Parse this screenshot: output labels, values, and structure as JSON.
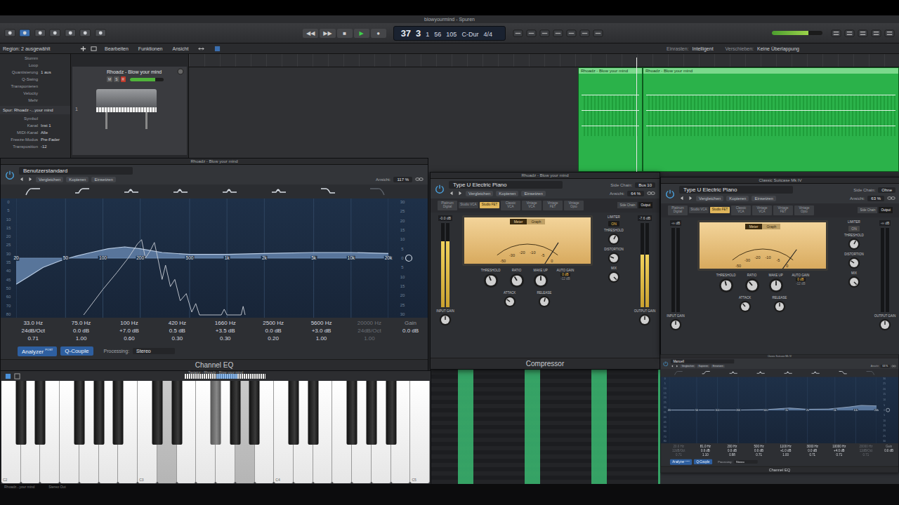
{
  "window": {
    "title": "blowyourmind - Spuren"
  },
  "toolbar": {
    "transport": [
      {
        "icon": "◀◀",
        "selected": false
      },
      {
        "icon": "▶▶",
        "selected": false
      },
      {
        "icon": "■",
        "selected": false
      },
      {
        "icon": "▶",
        "selected": true
      },
      {
        "icon": "●",
        "selected": false
      }
    ],
    "lcd": [
      {
        "value": "37",
        "kind": "position"
      },
      {
        "value": "3",
        "kind": "position"
      },
      {
        "value": "1",
        "kind": "info"
      },
      {
        "value": "56",
        "kind": "info"
      },
      {
        "value": "105",
        "kind": "info"
      },
      {
        "value": "C-Dur",
        "kind": "info"
      },
      {
        "value": "4/4",
        "kind": "info"
      }
    ],
    "master_level": 0.72
  },
  "inspector": {
    "region_title": "Region: 2 ausgewählt",
    "region_params": [
      {
        "label": "Stumm",
        "value": ""
      },
      {
        "label": "Loop",
        "value": ""
      },
      {
        "label": "Quantisierung",
        "value": "1 aus"
      },
      {
        "label": "Q-Swing",
        "value": ""
      },
      {
        "label": "Transponieren",
        "value": ""
      },
      {
        "label": "Velocity",
        "value": ""
      },
      {
        "label": "Mehr",
        "value": ""
      }
    ],
    "track_title": "Spur: Rhoadz -...your mind",
    "track_params": [
      {
        "label": "Symbol",
        "value": ""
      },
      {
        "label": "Kanal",
        "value": "Inst 1"
      },
      {
        "label": "MIDI-Kanal",
        "value": "Alle"
      },
      {
        "label": "Freeze-Modus",
        "value": "Pre-Fader"
      },
      {
        "label": "Transposition",
        "value": "-12"
      }
    ]
  },
  "track": {
    "number": "1",
    "name": "Rhoadz - Blow your mind",
    "buttons": [
      {
        "label": "M",
        "on": false
      },
      {
        "label": "S",
        "on": false
      },
      {
        "label": "R",
        "on": true
      }
    ],
    "volume": 0.75
  },
  "arrange": {
    "menus": [
      "Bearbeiten",
      "Funktionen",
      "Ansicht"
    ],
    "snap_label": "Einrasten:",
    "snap": "Intelligent",
    "drag_label": "Verschieben:",
    "drag": "Keine Überlappung",
    "regions": [
      {
        "name": "Rhoadz - Blow your mind",
        "selected": true
      },
      {
        "name": "Rhoadz - Blow your mind",
        "selected": true
      }
    ]
  },
  "eqs": [
    {
      "title": "Rhoadz - Blow your mind",
      "preset": "Benutzerstandard",
      "buttons": [
        "Vergleichen",
        "Kopieren",
        "Einsetzen"
      ],
      "view_label": "Ansicht:",
      "view": "117 %",
      "left_scale": [
        "0",
        "5",
        "10",
        "15",
        "20",
        "25",
        "30",
        "35",
        "40",
        "45",
        "50",
        "60",
        "70",
        "80"
      ],
      "right_scale": [
        "30",
        "25",
        "20",
        "15",
        "10",
        "5",
        "0",
        "5",
        "10",
        "15",
        "20",
        "25",
        "30"
      ],
      "ticks": [
        {
          "label": "20",
          "hz": 20
        },
        {
          "label": "50",
          "hz": 50
        },
        {
          "label": "100",
          "hz": 100
        },
        {
          "label": "200",
          "hz": 200
        },
        {
          "label": "500",
          "hz": 500
        },
        {
          "label": "1k",
          "hz": 1000
        },
        {
          "label": "2k",
          "hz": 2000
        },
        {
          "label": "5k",
          "hz": 5000
        },
        {
          "label": "10k",
          "hz": 10000
        },
        {
          "label": "20k",
          "hz": 20000
        }
      ],
      "curve": [
        [
          20,
          -14
        ],
        [
          25,
          -10
        ],
        [
          33,
          -5
        ],
        [
          45,
          -1.5
        ],
        [
          60,
          1
        ],
        [
          80,
          3
        ],
        [
          110,
          5
        ],
        [
          150,
          6
        ],
        [
          200,
          5
        ],
        [
          300,
          3
        ],
        [
          500,
          2
        ],
        [
          1000,
          2
        ],
        [
          2000,
          2.5
        ],
        [
          5000,
          3
        ],
        [
          10000,
          3
        ],
        [
          20000,
          2.5
        ]
      ],
      "analyzer": [
        [
          70,
          -80
        ],
        [
          100,
          -62
        ],
        [
          130,
          -50
        ],
        [
          160,
          -40
        ],
        [
          190,
          -30
        ],
        [
          205,
          -27
        ],
        [
          220,
          -40
        ],
        [
          240,
          -35
        ],
        [
          260,
          -29
        ],
        [
          280,
          -42
        ],
        [
          300,
          -55
        ],
        [
          320,
          -45
        ],
        [
          350,
          -60
        ],
        [
          380,
          -55
        ],
        [
          420,
          -70
        ],
        [
          470,
          -65
        ],
        [
          520,
          -78
        ],
        [
          560,
          -72
        ],
        [
          600,
          -80
        ],
        [
          900,
          -80
        ],
        [
          950,
          -76
        ],
        [
          1000,
          -80
        ],
        [
          1300,
          -80
        ],
        [
          1350,
          -74
        ],
        [
          1400,
          -80
        ]
      ],
      "bands": [
        {
          "kind": "lowcut",
          "freq": "33.0 Hz",
          "gain": "24dB/Oct",
          "q": "0.71",
          "enabled": true
        },
        {
          "kind": "lowshelf",
          "freq": "75.0 Hz",
          "gain": "0.0 dB",
          "q": "1.00",
          "enabled": true
        },
        {
          "kind": "bell",
          "freq": "100 Hz",
          "gain": "+7.0 dB",
          "q": "0.60",
          "enabled": true
        },
        {
          "kind": "bell",
          "freq": "420 Hz",
          "gain": "0.5 dB",
          "q": "0.30",
          "enabled": true
        },
        {
          "kind": "bell",
          "freq": "1660 Hz",
          "gain": "+3.5 dB",
          "q": "0.30",
          "enabled": true
        },
        {
          "kind": "bell",
          "freq": "2500 Hz",
          "gain": "0.0 dB",
          "q": "0.20",
          "enabled": true
        },
        {
          "kind": "highshelf",
          "freq": "5600 Hz",
          "gain": "+3.0 dB",
          "q": "1.00",
          "enabled": true
        },
        {
          "kind": "highcut",
          "freq": "20000 Hz",
          "gain": "24dB/Oct",
          "q": "1.00",
          "enabled": false
        }
      ],
      "gain": {
        "label": "Gain",
        "value": "0.0 dB"
      },
      "analyzer_button": {
        "label": "Analyzer",
        "badge": "POST",
        "on": true
      },
      "qcouple_button": {
        "label": "Q-Couple",
        "on": true
      },
      "processing_label": "Processing:",
      "processing": "Stereo",
      "footer": "Channel EQ"
    },
    {
      "title": "Classic Suitcase Mk IV",
      "preset": "Manuell",
      "buttons": [
        "Vergleichen",
        "Kopieren",
        "Einsetzen"
      ],
      "view_label": "Ansicht:",
      "view": "63 %",
      "left_scale": [
        "0",
        "5",
        "10",
        "15",
        "20",
        "25",
        "30",
        "35",
        "40",
        "45",
        "50",
        "60",
        "70",
        "80"
      ],
      "right_scale": [
        "30",
        "25",
        "20",
        "15",
        "10",
        "5",
        "0",
        "5",
        "10",
        "15",
        "20",
        "25",
        "30"
      ],
      "ticks": [
        {
          "label": "20",
          "hz": 20
        },
        {
          "label": "50",
          "hz": 50
        },
        {
          "label": "100",
          "hz": 100
        },
        {
          "label": "200",
          "hz": 200
        },
        {
          "label": "500",
          "hz": 500
        },
        {
          "label": "1k",
          "hz": 1000
        },
        {
          "label": "2k",
          "hz": 2000
        },
        {
          "label": "5k",
          "hz": 5000
        },
        {
          "label": "10k",
          "hz": 10000
        },
        {
          "label": "20k",
          "hz": 20000
        }
      ],
      "curve": [
        [
          20,
          0
        ],
        [
          200,
          0
        ],
        [
          500,
          0.5
        ],
        [
          1100,
          2
        ],
        [
          2000,
          0.8
        ],
        [
          4000,
          1
        ],
        [
          8000,
          3
        ],
        [
          12000,
          4.5
        ],
        [
          20000,
          4
        ]
      ],
      "analyzer": [],
      "bands": [
        {
          "kind": "lowcut",
          "freq": "20.0 Hz",
          "gain": "12dB/Oct",
          "q": "0.71",
          "enabled": false
        },
        {
          "kind": "lowshelf",
          "freq": "81.0 Hz",
          "gain": "0.0 dB",
          "q": "1.10",
          "enabled": true
        },
        {
          "kind": "bell",
          "freq": "200 Hz",
          "gain": "0.0 dB",
          "q": "0.98",
          "enabled": true
        },
        {
          "kind": "bell",
          "freq": "500 Hz",
          "gain": "0.0 dB",
          "q": "0.71",
          "enabled": true
        },
        {
          "kind": "bell",
          "freq": "1100 Hz",
          "gain": "+1.0 dB",
          "q": "1.00",
          "enabled": true
        },
        {
          "kind": "bell",
          "freq": "3000 Hz",
          "gain": "0.0 dB",
          "q": "0.71",
          "enabled": true
        },
        {
          "kind": "highshelf",
          "freq": "10000 Hz",
          "gain": "+4.0 dB",
          "q": "0.71",
          "enabled": true
        },
        {
          "kind": "highcut",
          "freq": "20000 Hz",
          "gain": "12dB/Oct",
          "q": "0.71",
          "enabled": false
        }
      ],
      "gain": {
        "label": "Gain",
        "value": "0.0 dB"
      },
      "analyzer_button": {
        "label": "Analyzer",
        "badge": "POST",
        "on": true
      },
      "qcouple_button": {
        "label": "Q-Couple",
        "on": true
      },
      "processing_label": "Processing:",
      "processing": "Stereo",
      "footer": "Channel EQ"
    }
  ],
  "compressors": [
    {
      "title": "Rhoadz - Blow your mind",
      "preset": "Type U Electric Piano",
      "side_chain_label": "Side Chain:",
      "side_chain": "Bus 10",
      "buttons": [
        "Vergleichen",
        "Kopieren",
        "Einsetzen"
      ],
      "view_label": "Ansicht:",
      "view": "64 %",
      "models": [
        {
          "label": "Platinum Digital",
          "selected": false
        },
        {
          "label": "Studio VCA",
          "selected": false
        },
        {
          "label": "Studio FET",
          "selected": true
        },
        {
          "label": "Classic VCA",
          "selected": false
        },
        {
          "label": "Vintage VCA",
          "selected": false
        },
        {
          "label": "Vintage FET",
          "selected": false
        },
        {
          "label": "Vintage Opto",
          "selected": false
        }
      ],
      "view_toggle": [
        {
          "label": "Side Chain",
          "selected": false
        },
        {
          "label": "Output",
          "selected": true
        }
      ],
      "meter_tabs": [
        {
          "label": "Meter",
          "selected": true
        },
        {
          "label": "Graph",
          "selected": false
        }
      ],
      "vu_scale": [
        "-50",
        "-30",
        "-20",
        "-10",
        "-5",
        "0"
      ],
      "needle": 0.86,
      "input_meter": {
        "reading": "-0.0 dB",
        "level": 0.78
      },
      "output_meter": {
        "reading": "-7.6 dB",
        "level": 0.62
      },
      "knobs_top": [
        {
          "label": "THRESHOLD",
          "level": 0.42
        },
        {
          "label": "RATIO",
          "level": 0.38
        },
        {
          "label": "MAKE UP",
          "level": 0.5
        }
      ],
      "knobs_bottom": [
        {
          "label": "ATTACK",
          "level": 0.3
        },
        {
          "label": "RELEASE",
          "level": 0.55
        }
      ],
      "auto_gain": {
        "label": "AUTO GAIN",
        "options": [
          {
            "label": "0 dB",
            "selected": true
          },
          {
            "label": "-12 dB",
            "selected": false
          }
        ]
      },
      "limiter": {
        "label": "LIMITER",
        "button": "ON",
        "on": true,
        "knob": {
          "label": "THRESHOLD",
          "level": 0.6
        }
      },
      "distortion": {
        "label": "DISTORTION",
        "level": 0.25
      },
      "mix": {
        "label": "MIX",
        "level": 1
      },
      "input_gain": {
        "label": "INPUT GAIN",
        "level": 0.5
      },
      "output_gain": {
        "label": "OUTPUT GAIN",
        "level": 0.5
      },
      "footer": "Compressor"
    },
    {
      "title": "Classic Suitcase Mk IV",
      "preset": "Type U Electric Piano",
      "side_chain_label": "Side Chain:",
      "side_chain": "Ohne",
      "buttons": [
        "Vergleichen",
        "Kopieren",
        "Einsetzen"
      ],
      "view_label": "Ansicht:",
      "view": "63 %",
      "models": [
        {
          "label": "Platinum Digital",
          "selected": false
        },
        {
          "label": "Studio VCA",
          "selected": false
        },
        {
          "label": "Studio FET",
          "selected": true
        },
        {
          "label": "Classic VCA",
          "selected": false
        },
        {
          "label": "Vintage VCA",
          "selected": false
        },
        {
          "label": "Vintage FET",
          "selected": false
        },
        {
          "label": "Vintage Opto",
          "selected": false
        }
      ],
      "view_toggle": [
        {
          "label": "Side Chain",
          "selected": false
        },
        {
          "label": "Output",
          "selected": true
        }
      ],
      "meter_tabs": [
        {
          "label": "Meter",
          "selected": true
        },
        {
          "label": "Graph",
          "selected": false
        }
      ],
      "vu_scale": [
        "-50",
        "-30",
        "-20",
        "-10",
        "-5",
        "0"
      ],
      "needle": 0.9,
      "input_meter": {
        "reading": "-∞ dB",
        "level": 0
      },
      "output_meter": {
        "reading": "-∞ dB",
        "level": 0
      },
      "knobs_top": [
        {
          "label": "THRESHOLD",
          "level": 0.45
        },
        {
          "label": "RATIO",
          "level": 0.35
        },
        {
          "label": "MAKE UP",
          "level": 0.5
        }
      ],
      "knobs_bottom": [
        {
          "label": "ATTACK",
          "level": 0.35
        },
        {
          "label": "RELEASE",
          "level": 0.5
        }
      ],
      "auto_gain": {
        "label": "AUTO GAIN",
        "options": [
          {
            "label": "0 dB",
            "selected": true
          },
          {
            "label": "-12 dB",
            "selected": false
          }
        ]
      },
      "limiter": {
        "label": "LIMITER",
        "button": "ON",
        "on": false,
        "knob": {
          "label": "THRESHOLD",
          "level": 0.6
        }
      },
      "distortion": {
        "label": "DISTORTION",
        "level": 0.3
      },
      "mix": {
        "label": "MIX",
        "level": 1
      },
      "input_gain": {
        "label": "INPUT GAIN",
        "level": 0.5
      },
      "output_gain": {
        "label": "OUTPUT GAIN",
        "level": 0.5
      },
      "footer": ""
    }
  ],
  "keyboard": {
    "title": "Tastatur - Rhoadz - Blow your mind",
    "octave_labels": [
      "C2",
      "C3",
      "C4",
      "C5"
    ],
    "white_keys": [
      {
        "pressed": false
      },
      {
        "pressed": false
      },
      {
        "pressed": false
      },
      {
        "pressed": false
      },
      {
        "pressed": false
      },
      {
        "pressed": false
      },
      {
        "pressed": false
      },
      {
        "pressed": false
      },
      {
        "pressed": true
      },
      {
        "pressed": false
      },
      {
        "pressed": false
      },
      {
        "pressed": false
      },
      {
        "pressed": true
      },
      {
        "pressed": false
      },
      {
        "pressed": false
      },
      {
        "pressed": false
      },
      {
        "pressed": false
      },
      {
        "pressed": false
      },
      {
        "pressed": false
      },
      {
        "pressed": false
      },
      {
        "pressed": false
      },
      {
        "pressed": false
      }
    ],
    "black_keys": [
      {
        "pressed": false
      },
      {
        "pressed": false
      },
      {
        "pressed": false
      },
      {
        "pressed": false
      },
      {
        "pressed": false
      },
      {
        "pressed": false
      },
      {
        "pressed": false
      },
      {
        "pressed": true
      },
      {
        "pressed": false
      },
      {
        "pressed": false
      },
      {
        "pressed": false
      },
      {
        "pressed": false
      },
      {
        "pressed": false
      },
      {
        "pressed": false
      },
      {
        "pressed": false
      }
    ]
  },
  "footer_strip": [
    "Rhoadz...your mind",
    "Stereo Out"
  ]
}
